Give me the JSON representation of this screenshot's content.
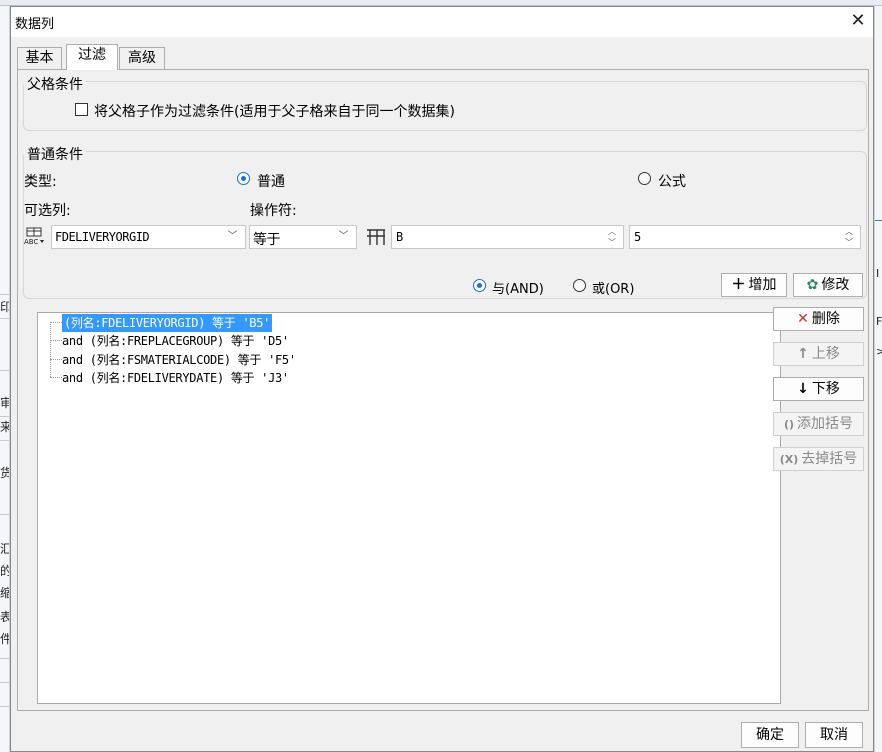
{
  "dialog": {
    "title": "数据列",
    "close": "✕"
  },
  "tabs": [
    {
      "label": "基本"
    },
    {
      "label": "过滤"
    },
    {
      "label": "高级"
    }
  ],
  "parent_condition": {
    "legend": "父格条件",
    "checkbox_label": "将父格子作为过滤条件(适用于父子格来自于同一个数据集)",
    "checked": false
  },
  "normal_condition": {
    "legend": "普通条件",
    "type_label": "类型:",
    "type_options": [
      {
        "label": "普通",
        "selected": true
      },
      {
        "label": "公式",
        "selected": false
      }
    ],
    "column_label": "可选列:",
    "operator_label": "操作符:",
    "column_value": "FDELIVERYORGID",
    "operator_value": "等于",
    "value_text": "B",
    "value_number": "5"
  },
  "logic": {
    "and_label": "与(AND)",
    "or_label": "或(OR)",
    "and_selected": true
  },
  "buttons": {
    "add": "增加",
    "edit": "修改",
    "delete": "删除",
    "move_up": "上移",
    "move_down": "下移",
    "add_bracket": "添加括号",
    "remove_bracket": "去掉括号",
    "ok": "确定",
    "cancel": "取消"
  },
  "conditions": [
    "(列名:FDELIVERYORGID) 等于 'B5'",
    "and (列名:FREPLACEGROUP) 等于 'D5'",
    "and (列名:FSMATERIALCODE) 等于 'F5'",
    "and (列名:FDELIVERYDATE) 等于 'J3'"
  ],
  "background": {
    "left_chars": [
      "印",
      "审",
      "来",
      "货",
      "汇",
      "的",
      "缩",
      "表",
      "件"
    ],
    "right_chars": [
      "I",
      "F",
      ">"
    ]
  },
  "colors": {
    "accent": "#1a6ed8",
    "selection": "#3399ff",
    "delete_red": "#d0312d"
  }
}
